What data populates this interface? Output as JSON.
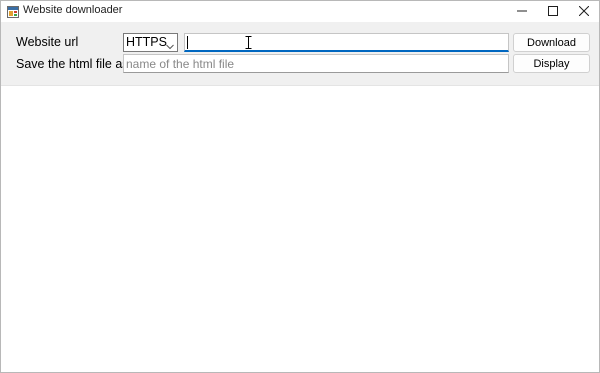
{
  "window": {
    "title": "Website downloader"
  },
  "form": {
    "url_label": "Website url",
    "protocol_selected": "HTTPS",
    "url_value": "",
    "save_label": "Save the html file as",
    "filename_placeholder": "name of the html file",
    "download_label": "Download",
    "display_label": "Display"
  },
  "icons": {
    "app": "app-window-icon",
    "minimize": "minimize-icon",
    "maximize": "maximize-icon",
    "close": "close-icon",
    "dropdown": "chevron-down-icon",
    "cursor": "text-cursor-icon"
  },
  "colors": {
    "accent": "#0067c0",
    "panel": "#f0f0f0"
  }
}
